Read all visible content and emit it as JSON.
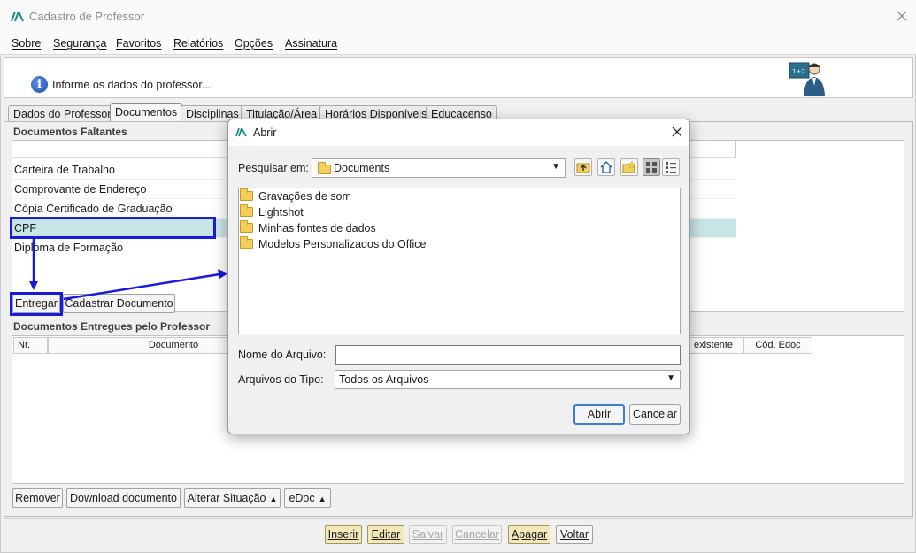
{
  "window": {
    "title": "Cadastro de Professor"
  },
  "menu": [
    "Sobre",
    "Segurança",
    "Favoritos",
    "Relatórios",
    "Opções",
    "Assinatura"
  ],
  "info": {
    "text": "Informe os dados do professor..."
  },
  "tabs": [
    "Dados do Professor",
    "Documentos",
    "Disciplinas",
    "Titulação/Área",
    "Horários Disponíveis",
    "Educacenso"
  ],
  "active_tab": "Documentos",
  "faltantes": {
    "label": "Documentos Faltantes",
    "rows": [
      "Carteira de Trabalho",
      "Comprovante de Endereço",
      "Cópia Certificado de Graduação",
      "CPF",
      "Diploma de Formação"
    ],
    "selected": "CPF",
    "buttons": {
      "entregar": "Entregar",
      "cadastrar": "Cadastrar Documento"
    }
  },
  "entregues": {
    "label": "Documentos Entregues pelo Professor",
    "columns": [
      "Nr.",
      "Documento",
      "existente",
      "Cód. Edoc"
    ],
    "buttons": {
      "remover": "Remover",
      "download": "Download documento",
      "alterar": "Alterar Situação",
      "edoc": "eDoc"
    }
  },
  "bottom_buttons": {
    "inserir": "Inserir",
    "editar": "Editar",
    "salvar": "Salvar",
    "cancelar": "Cancelar",
    "apagar": "Apagar",
    "voltar": "Voltar"
  },
  "dialog": {
    "title": "Abrir",
    "look_in_label": "Pesquisar em:",
    "look_in_value": "Documents",
    "items": [
      "Gravações de som",
      "Lightshot",
      "Minhas fontes de dados",
      "Modelos Personalizados do Office"
    ],
    "filename_label": "Nome do Arquivo:",
    "filename_value": "",
    "filetype_label": "Arquivos do Tipo:",
    "filetype_value": "Todos os Arquivos",
    "open_button": "Abrir",
    "cancel_button": "Cancelar"
  },
  "colors": {
    "annotation": "#1a1adb",
    "selection": "#c8e5e6",
    "highlight_button": "#f3e9b8"
  }
}
